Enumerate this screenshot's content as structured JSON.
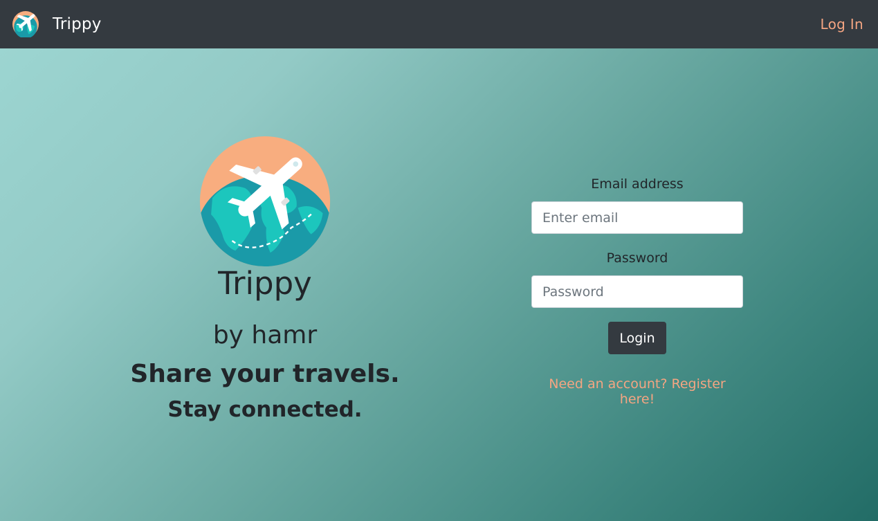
{
  "navbar": {
    "brand_name": "Trippy",
    "login_link": "Log In",
    "logo_icon": "plane-globe-icon"
  },
  "hero": {
    "logo_icon": "plane-globe-icon",
    "title": "Trippy",
    "byline": "by hamr",
    "tagline": "Share your travels.",
    "subtagline": "Stay connected."
  },
  "login_form": {
    "email_label": "Email address",
    "email_placeholder": "Enter email",
    "email_value": "",
    "password_label": "Password",
    "password_placeholder": "Password",
    "password_value": "",
    "submit_label": "Login",
    "register_link": "Need an account? Register here!"
  },
  "colors": {
    "navbar_bg": "#343a40",
    "accent": "#f4a582",
    "logo_peach": "#f8ad7f",
    "logo_teal": "#1a9aa8",
    "logo_land": "#1cc6bd",
    "button_bg": "#343a40",
    "background_light": "#9cd5d1",
    "background_dark": "#226c66"
  }
}
